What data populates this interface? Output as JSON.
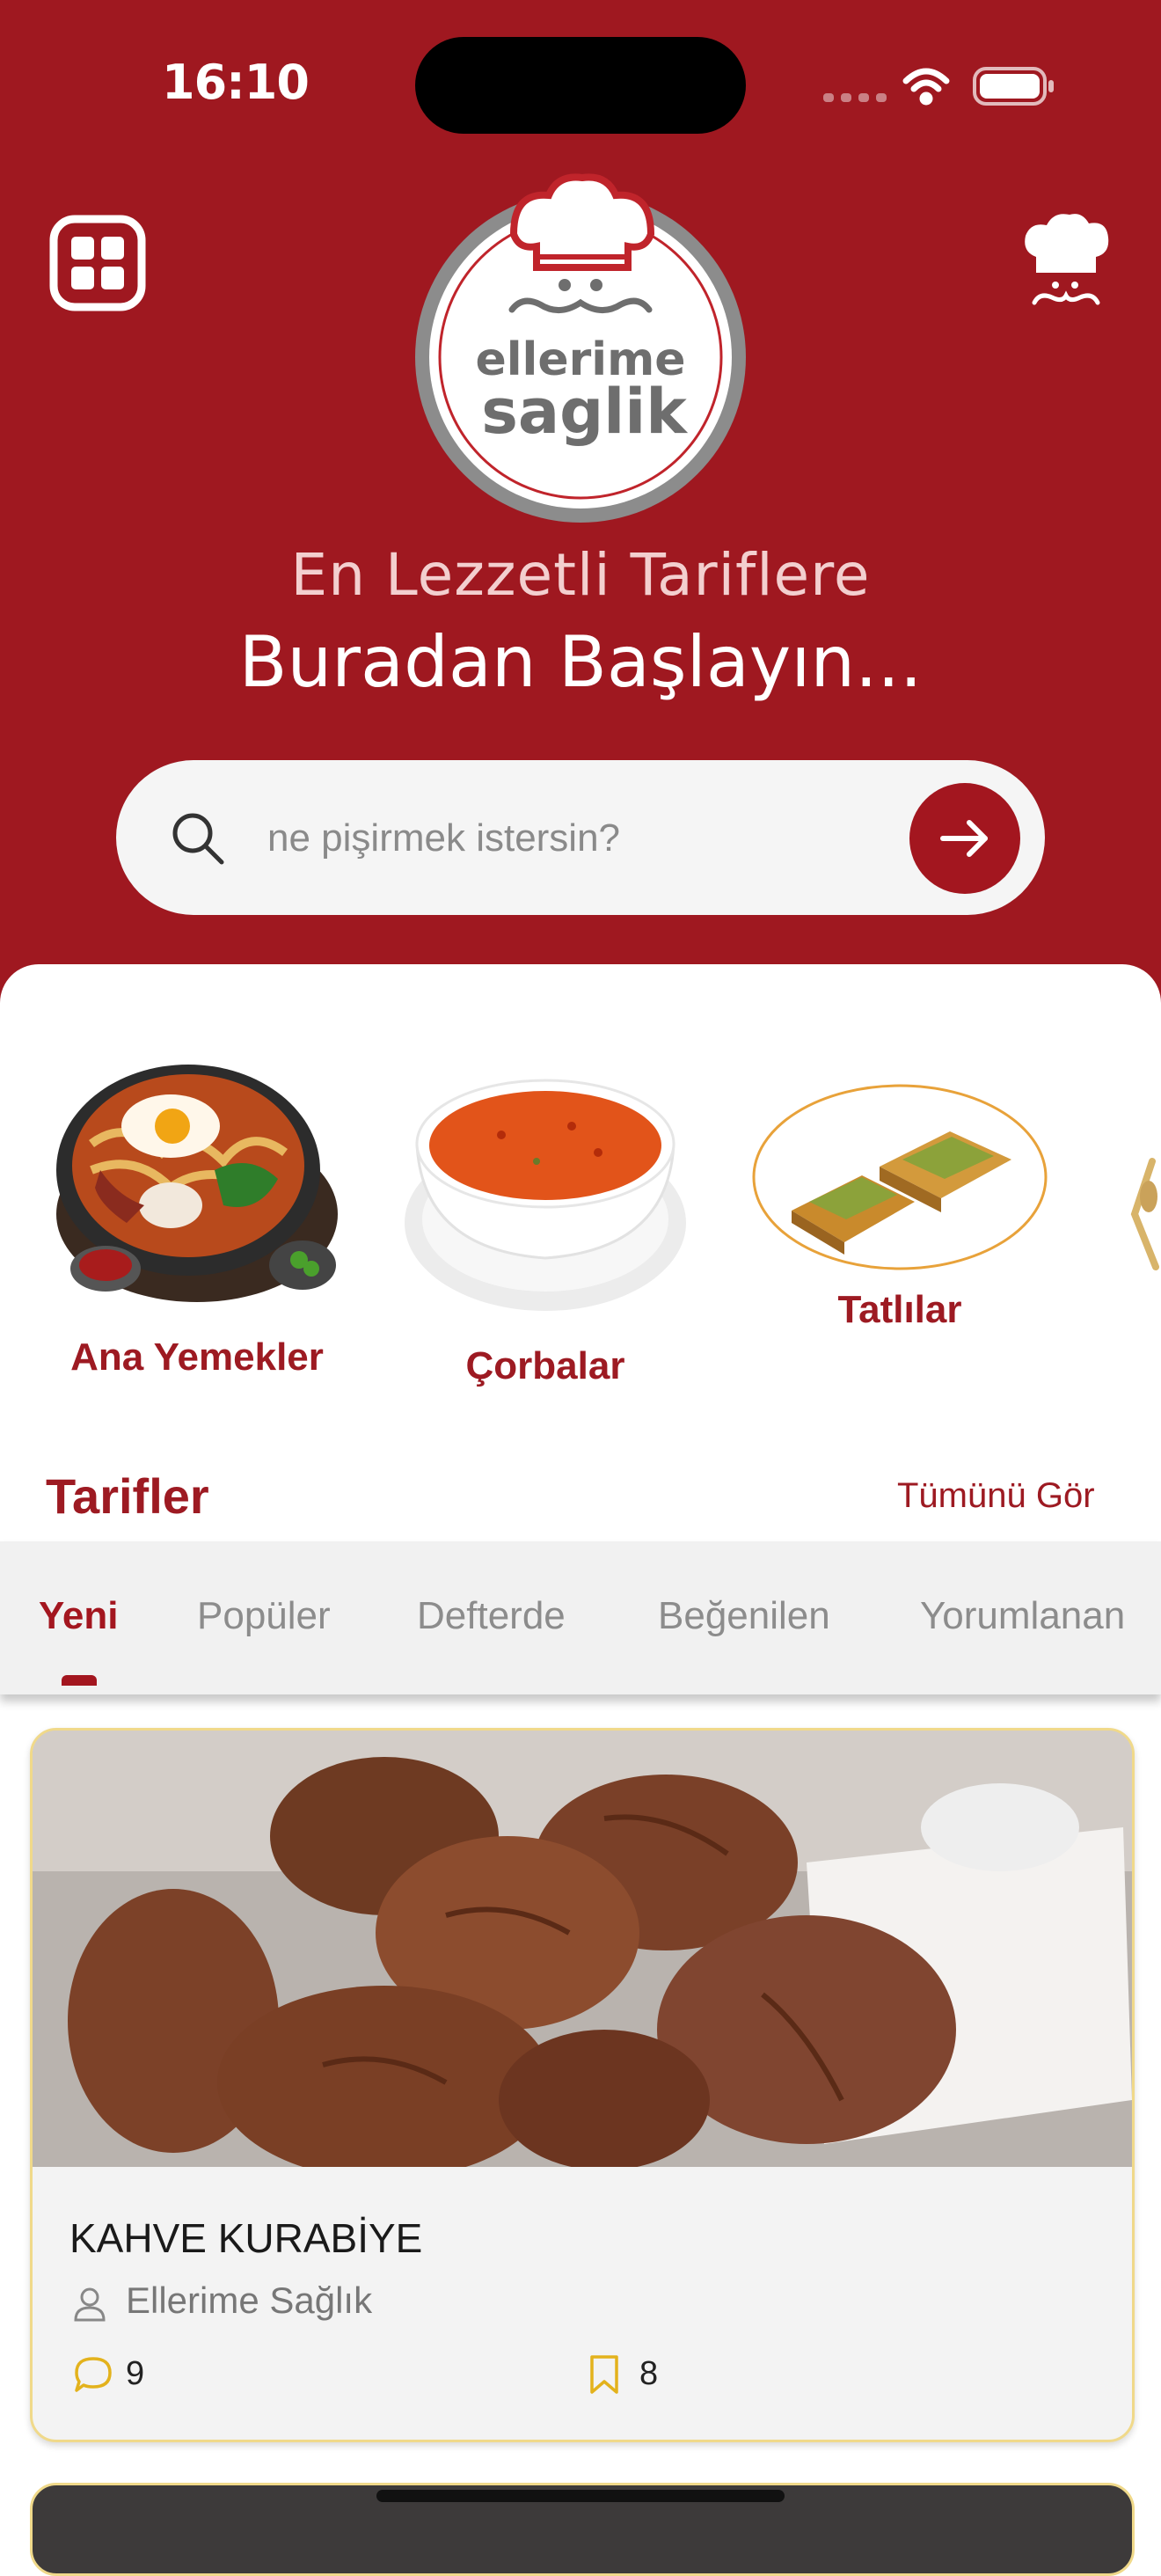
{
  "status_bar": {
    "time": "16:10"
  },
  "brand": {
    "logo_line1": "ellerime",
    "logo_line2": "saglik",
    "primary_color": "#9f1820"
  },
  "header": {
    "menu_icon": "grid-icon",
    "profile_icon": "chef-icon",
    "tagline_line1": "En Lezzetli Tariflere",
    "tagline_line2": "Buradan Başlayın..."
  },
  "search": {
    "placeholder": "ne pişirmek istersin?",
    "submit_icon": "arrow-right-icon"
  },
  "categories": [
    {
      "label": "Ana Yemekler"
    },
    {
      "label": "Çorbalar"
    },
    {
      "label": "Tatlılar"
    }
  ],
  "recipes_section": {
    "title": "Tarifler",
    "see_all": "Tümünü Gör",
    "tabs": [
      {
        "label": "Yeni",
        "active": true
      },
      {
        "label": "Popüler"
      },
      {
        "label": "Defterde"
      },
      {
        "label": "Beğenilen"
      },
      {
        "label": "Yorumlanan"
      }
    ]
  },
  "recipe_cards": [
    {
      "title": "KAHVE KURABİYE",
      "author": "Ellerime Sağlık",
      "comments": "9",
      "bookmarks": "8"
    }
  ]
}
